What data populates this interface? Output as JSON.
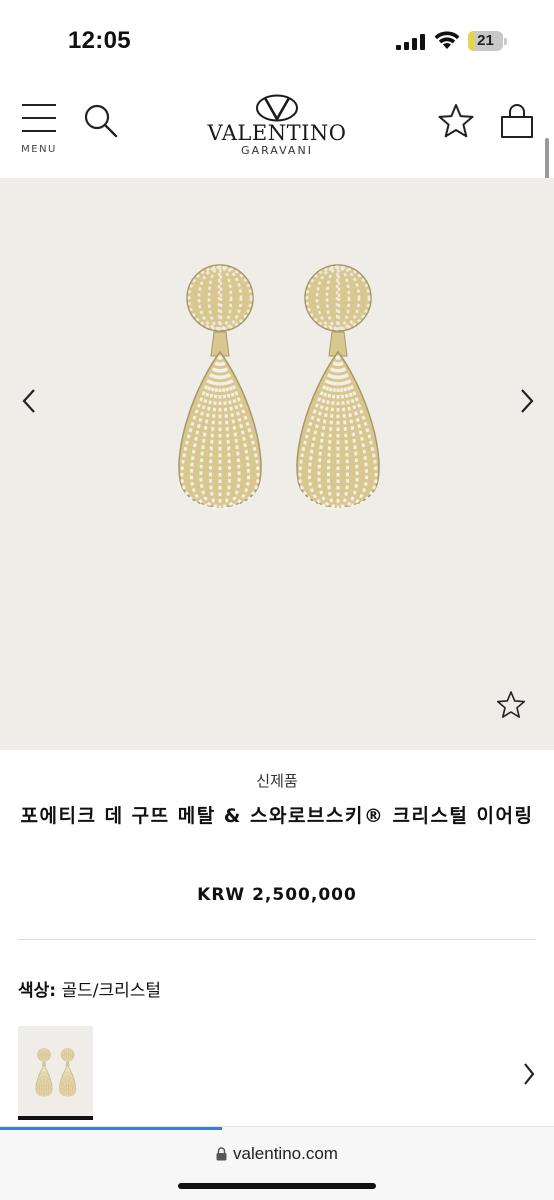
{
  "status_bar": {
    "time": "12:05",
    "battery_level": "21",
    "battery_fraction": 0.21,
    "battery_color": "#e5d44d"
  },
  "header": {
    "menu_label": "MENU",
    "brand_name": "VALENTINO",
    "brand_sub": "GARAVANI"
  },
  "product": {
    "badge": "신제품",
    "title": "포에티크 데 구뜨 메탈 & 스와로브스키® 크리스털 이어링",
    "price": "KRW 2,500,000",
    "color_label": "색상:",
    "color_value": "골드/크리스털",
    "image_background": "#f0ede9",
    "metal_color": "#d8c78f"
  },
  "browser": {
    "url": "valentino.com",
    "load_progress": 0.4,
    "accent": "#3c7fd6"
  }
}
